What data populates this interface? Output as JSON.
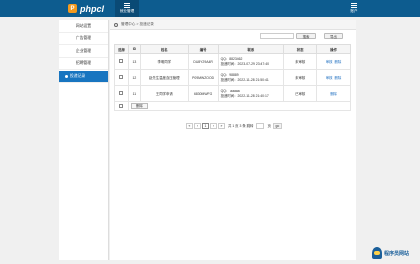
{
  "app": {
    "logo_mark": "P",
    "logo_text": "phpcl",
    "nav_label": "就业管理",
    "user_label": "账户"
  },
  "sidebar": {
    "items": [
      {
        "label": "网站设置"
      },
      {
        "label": "广告管理"
      },
      {
        "label": "企业管理"
      },
      {
        "label": "招聘管理"
      },
      {
        "label": "投递记录"
      }
    ]
  },
  "breadcrumb": {
    "text": "管理中心 > 投递记录"
  },
  "toolbar": {
    "search_placeholder": "",
    "search_label": "搜索",
    "export_label": "导出"
  },
  "table": {
    "headers": [
      "选择",
      "ID",
      "姓名",
      "编号",
      "联系",
      "状态",
      "操作"
    ],
    "rows": [
      {
        "id": "13",
        "name": "李明同学",
        "code": "DU8Y29A4R",
        "contact1": "QQ：8823462",
        "contact2": "投递时间：2023-07-29 23:47:40",
        "status": "未审核",
        "op1": "审核",
        "op2": "删除"
      },
      {
        "id": "12",
        "name": "赵先生温度血压管理",
        "code": "P09MWZOOD",
        "contact1": "QQ：98889",
        "contact2": "投递时间：2022-11-28 21:50:41",
        "status": "未审核",
        "op1": "审核",
        "op2": "删除"
      },
      {
        "id": "11",
        "name": "王同学申请",
        "code": "6830MWFG",
        "contact1": "QQ： aaaaa",
        "contact2": "投递时间：2022-11-28 21:40:17",
        "status": "已审核",
        "op1": "删除",
        "op2": ""
      }
    ],
    "delete_label": "删除"
  },
  "pager": {
    "first": "«",
    "prev": "‹",
    "current": "1",
    "next": "›",
    "last": "»",
    "summary": "共 1 页 3 条 跳转",
    "page_unit": "页",
    "go": "go"
  },
  "watermark": {
    "text": "程序员网站"
  }
}
